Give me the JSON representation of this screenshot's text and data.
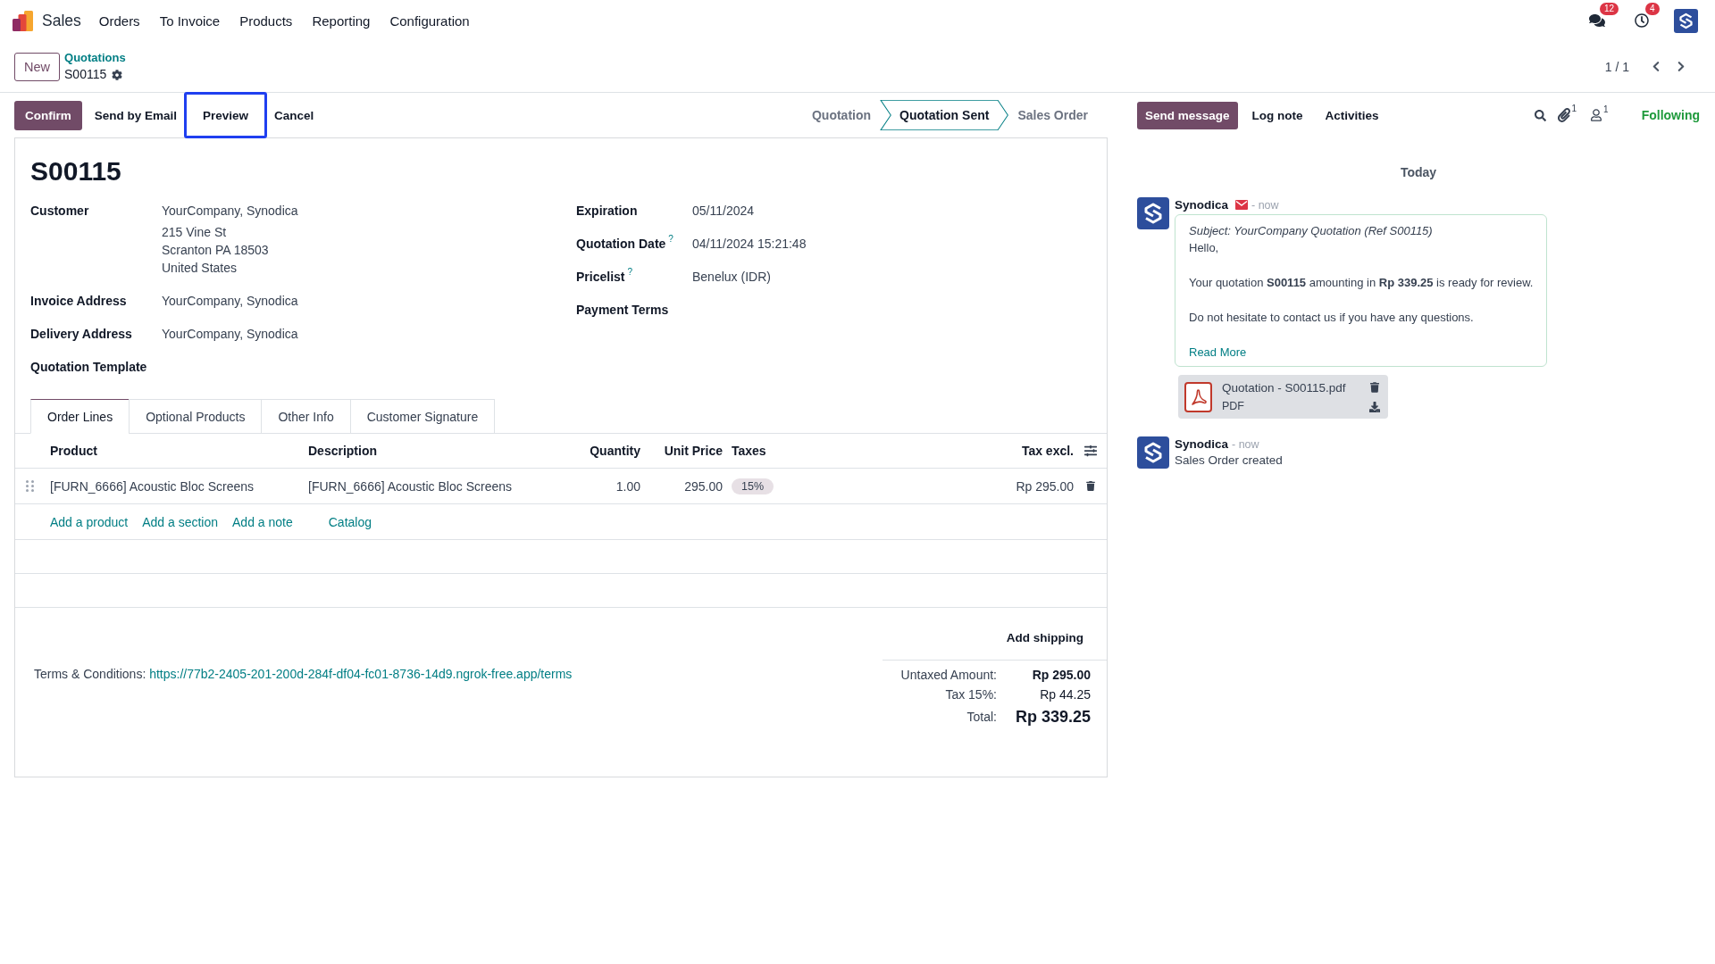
{
  "navbar": {
    "app_name": "Sales",
    "menu": [
      "Orders",
      "To Invoice",
      "Products",
      "Reporting",
      "Configuration"
    ],
    "messages_badge": "12",
    "activities_badge": "4"
  },
  "control_panel": {
    "new_button": "New",
    "breadcrumb": "Quotations",
    "record_name": "S00115",
    "pager": "1 / 1"
  },
  "actions": [
    {
      "label": "Confirm",
      "kind": "primary",
      "highlighted": false
    },
    {
      "label": "Send by Email",
      "kind": "secondary",
      "highlighted": false
    },
    {
      "label": "Preview",
      "kind": "secondary",
      "highlighted": true
    },
    {
      "label": "Cancel",
      "kind": "secondary",
      "highlighted": false
    }
  ],
  "statusbar": [
    {
      "label": "Quotation",
      "selected": false
    },
    {
      "label": "Quotation Sent",
      "selected": true
    },
    {
      "label": "Sales Order",
      "selected": false
    }
  ],
  "chatter_toolbar": {
    "send_message": "Send message",
    "log_note": "Log note",
    "activities": "Activities",
    "attachments_count": "1",
    "followers_count": "1",
    "follow_button": "Following"
  },
  "form": {
    "title": "S00115",
    "left_fields": [
      {
        "label": "Customer",
        "lines": [
          "YourCompany, Synodica",
          "215 Vine St",
          "Scranton PA 18503",
          "United States"
        ]
      },
      {
        "label": "Invoice Address",
        "lines": [
          "YourCompany, Synodica"
        ]
      },
      {
        "label": "Delivery Address",
        "lines": [
          "YourCompany, Synodica"
        ]
      },
      {
        "label": "Quotation Template"
      }
    ],
    "right_fields": [
      {
        "label": "Expiration",
        "value": "05/11/2024"
      },
      {
        "label": "Quotation Date",
        "help": "?",
        "value": "04/11/2024 15:21:48"
      },
      {
        "label": "Pricelist",
        "help": "?",
        "value": "Benelux (IDR)"
      },
      {
        "label": "Payment Terms"
      }
    ]
  },
  "tabs": [
    {
      "label": "Order Lines",
      "selected": true
    },
    {
      "label": "Optional Products",
      "selected": false
    },
    {
      "label": "Other Info",
      "selected": false
    },
    {
      "label": "Customer Signature",
      "selected": false
    }
  ],
  "order_lines": {
    "columns": [
      "Product",
      "Description",
      "Quantity",
      "Unit Price",
      "Taxes",
      "Tax excl."
    ],
    "rows": [
      {
        "product": "[FURN_6666] Acoustic Bloc Screens",
        "description": "[FURN_6666] Acoustic Bloc Screens",
        "quantity": "1.00",
        "unit_price": "295.00",
        "taxes": "15%",
        "subtotal": "Rp 295.00"
      }
    ],
    "add_links": [
      "Add a product",
      "Add a section",
      "Add a note"
    ],
    "catalog": "Catalog"
  },
  "add_shipping": "Add shipping",
  "terms": {
    "label": "Terms & Conditions:",
    "link": "https://77b2-2405-201-200d-284f-df04-fc01-8736-14d9.ngrok-free.app/terms"
  },
  "totals": [
    {
      "label": "Untaxed Amount:",
      "value": "Rp 295.00",
      "kind": "subtotal"
    },
    {
      "label": "Tax 15%:",
      "value": "Rp 44.25",
      "kind": "tax"
    },
    {
      "label": "Total:",
      "value": "Rp 339.25",
      "kind": "total"
    }
  ],
  "chatter": {
    "date_separator": "Today",
    "messages": [
      {
        "kind": "email",
        "author": "Synodica",
        "time": "- now",
        "subject": "Subject: YourCompany Quotation (Ref S00115)",
        "paragraphs": [
          "Hello,",
          "Your quotation **S00115** amounting in **Rp 339.25** is ready for review.",
          "Do not hesitate to contact us if you have any questions."
        ],
        "read_more": "Read More",
        "attachments": [
          {
            "name": "Quotation - S00115.pdf",
            "type": "PDF"
          }
        ]
      },
      {
        "kind": "notification",
        "author": "Synodica",
        "time": "- now",
        "text": "Sales Order created"
      }
    ]
  }
}
